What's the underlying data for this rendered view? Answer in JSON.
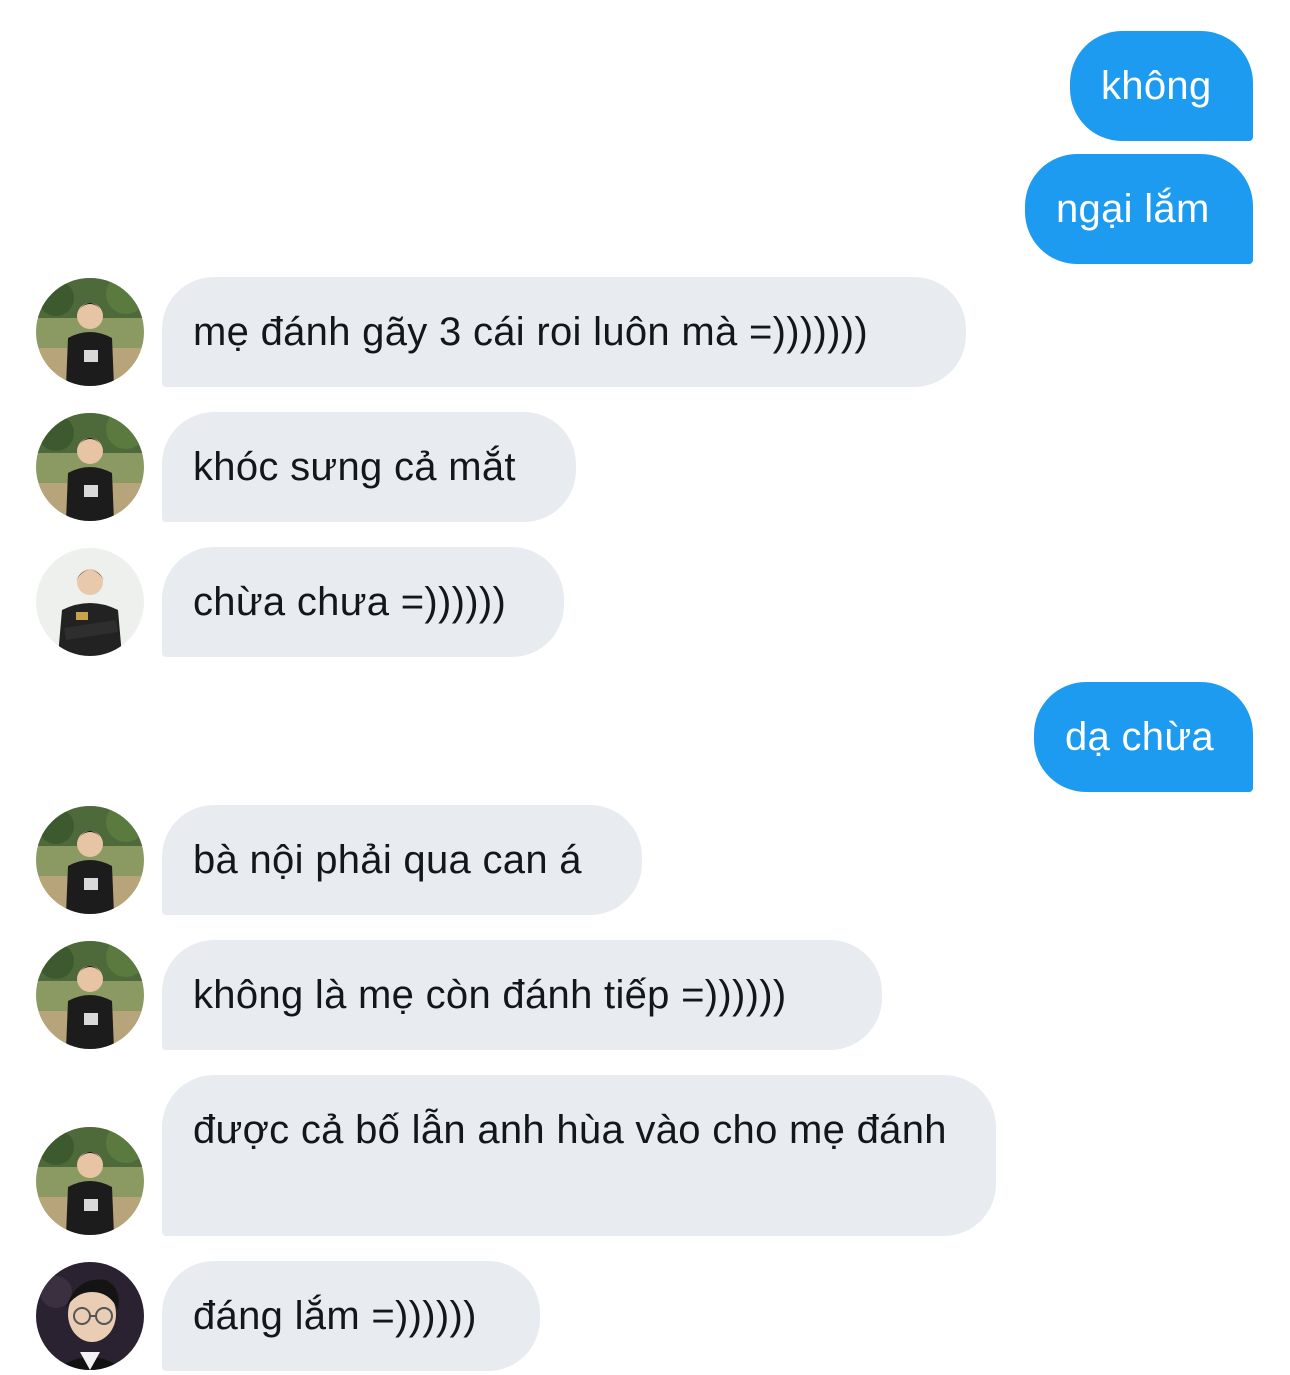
{
  "conversation": {
    "messages": [
      {
        "direction": "out",
        "text": "không"
      },
      {
        "direction": "out",
        "text": "ngại lắm"
      },
      {
        "direction": "in",
        "avatar": "player-jersey-field-avatar",
        "text": "mẹ đánh gãy 3 cái roi luôn mà =)))))))"
      },
      {
        "direction": "in",
        "avatar": "player-jersey-field-avatar",
        "text": "khóc sưng cả mắt"
      },
      {
        "direction": "in",
        "avatar": "player-arms-crossed-avatar",
        "text": "chừa chưa =))))))"
      },
      {
        "direction": "out",
        "text": "dạ chừa"
      },
      {
        "direction": "in",
        "avatar": "player-jersey-field-avatar",
        "text": "bà nội phải qua can á"
      },
      {
        "direction": "in",
        "avatar": "player-jersey-field-avatar",
        "text": "không là mẹ còn đánh tiếp =))))))"
      },
      {
        "direction": "in",
        "avatar": "player-jersey-field-avatar",
        "text": "được cả bố lẫn anh hùa vào cho mẹ đánh"
      },
      {
        "direction": "in",
        "avatar": "player-glasses-portrait-avatar",
        "text": "đáng lắm =))))))"
      }
    ]
  },
  "colors": {
    "outgoing_bubble": "#1d9bf0",
    "incoming_bubble": "#e8ecf0",
    "incoming_text": "#14171a",
    "outgoing_text": "#ffffff"
  }
}
